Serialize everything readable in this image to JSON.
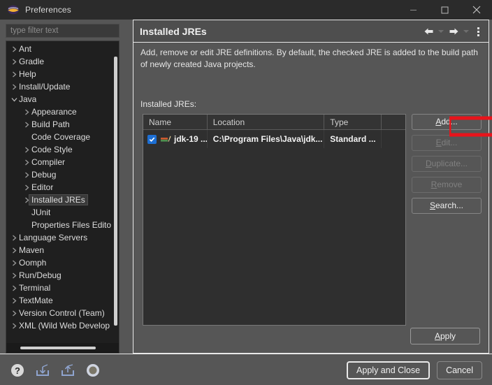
{
  "window": {
    "title": "Preferences",
    "app_icon": "eclipse-icon",
    "minimize_label": "Minimize",
    "maximize_label": "Maximize",
    "close_label": "Close"
  },
  "filter": {
    "placeholder": "type filter text",
    "value": ""
  },
  "tree": {
    "selected": "Installed JREs",
    "items": [
      {
        "label": "Ant",
        "depth": 1,
        "expandable": true,
        "expanded": false
      },
      {
        "label": "Gradle",
        "depth": 1,
        "expandable": true,
        "expanded": false
      },
      {
        "label": "Help",
        "depth": 1,
        "expandable": true,
        "expanded": false
      },
      {
        "label": "Install/Update",
        "depth": 1,
        "expandable": true,
        "expanded": false
      },
      {
        "label": "Java",
        "depth": 1,
        "expandable": true,
        "expanded": true
      },
      {
        "label": "Appearance",
        "depth": 2,
        "expandable": true,
        "expanded": false
      },
      {
        "label": "Build Path",
        "depth": 2,
        "expandable": true,
        "expanded": false
      },
      {
        "label": "Code Coverage",
        "depth": 2,
        "expandable": false,
        "expanded": false
      },
      {
        "label": "Code Style",
        "depth": 2,
        "expandable": true,
        "expanded": false
      },
      {
        "label": "Compiler",
        "depth": 2,
        "expandable": true,
        "expanded": false
      },
      {
        "label": "Debug",
        "depth": 2,
        "expandable": true,
        "expanded": false
      },
      {
        "label": "Editor",
        "depth": 2,
        "expandable": true,
        "expanded": false
      },
      {
        "label": "Installed JREs",
        "depth": 2,
        "expandable": true,
        "expanded": false
      },
      {
        "label": "JUnit",
        "depth": 2,
        "expandable": false,
        "expanded": false
      },
      {
        "label": "Properties Files Editor",
        "depth": 2,
        "expandable": false,
        "expanded": false
      },
      {
        "label": "Language Servers",
        "depth": 1,
        "expandable": true,
        "expanded": false
      },
      {
        "label": "Maven",
        "depth": 1,
        "expandable": true,
        "expanded": false
      },
      {
        "label": "Oomph",
        "depth": 1,
        "expandable": true,
        "expanded": false
      },
      {
        "label": "Run/Debug",
        "depth": 1,
        "expandable": true,
        "expanded": false
      },
      {
        "label": "Terminal",
        "depth": 1,
        "expandable": true,
        "expanded": false
      },
      {
        "label": "TextMate",
        "depth": 1,
        "expandable": true,
        "expanded": false
      },
      {
        "label": "Version Control (Team)",
        "depth": 1,
        "expandable": true,
        "expanded": false
      },
      {
        "label": "XML (Wild Web Develop",
        "depth": 1,
        "expandable": true,
        "expanded": false
      }
    ]
  },
  "panel": {
    "title": "Installed JREs",
    "description": "Add, remove or edit JRE definitions. By default, the checked JRE is added to the build path of newly created Java projects.",
    "table_label": "Installed JREs:",
    "nav": {
      "back_icon": "arrow-left-icon",
      "back_caret_icon": "chevron-down-icon",
      "forward_icon": "arrow-right-icon",
      "forward_caret_icon": "chevron-down-icon",
      "menu_icon": "kebab-menu-icon"
    }
  },
  "table": {
    "columns": [
      "Name",
      "Location",
      "Type",
      ""
    ],
    "rows": [
      {
        "checked": true,
        "icon": "jre-library-icon",
        "name": "jdk-19 ...",
        "location": "C:\\Program Files\\Java\\jdk...",
        "type": "Standard ...",
        "pad": ""
      }
    ]
  },
  "side_buttons": [
    {
      "label": "Add...",
      "mnemonic": "A",
      "enabled": true
    },
    {
      "label": "Edit...",
      "mnemonic": "E",
      "enabled": false
    },
    {
      "label": "Duplicate...",
      "mnemonic": "D",
      "enabled": false
    },
    {
      "label": "Remove",
      "mnemonic": "R",
      "enabled": false
    },
    {
      "label": "Search...",
      "mnemonic": "S",
      "enabled": true
    }
  ],
  "apply_button": {
    "label": "Apply",
    "mnemonic": "A"
  },
  "bottom": {
    "icons": [
      {
        "name": "help-icon",
        "title": "Help"
      },
      {
        "name": "import-icon",
        "title": "Import preferences"
      },
      {
        "name": "export-icon",
        "title": "Export preferences"
      },
      {
        "name": "preferences-dot-icon",
        "title": "Preferences"
      }
    ],
    "buttons": [
      {
        "label": "Apply and Close",
        "default": true
      },
      {
        "label": "Cancel",
        "default": false
      }
    ]
  },
  "annotation": {
    "type": "arrow",
    "direction": "right",
    "color": "#e8141b",
    "points_to": "Add..."
  },
  "colors": {
    "dialog_bg": "#565656",
    "tree_bg": "#1f1f1f",
    "table_bg": "#2f2f2f",
    "titlebar_bg": "#2b2b2b",
    "accent_checkbox": "#1d6fd4",
    "annotation_red": "#e8141b"
  }
}
